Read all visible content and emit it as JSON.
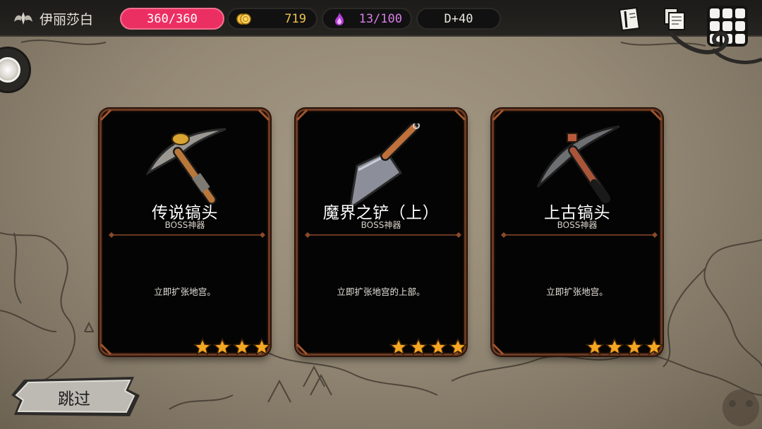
{
  "player": {
    "name": "伊丽莎白",
    "emblem_icon": "demon-wings-emblem-icon"
  },
  "stats": {
    "hp": "360/360",
    "gold": "719",
    "gold_icon": "gold-coins-icon",
    "soul": "13/100",
    "soul_icon": "purple-flame-icon",
    "day": "D+40"
  },
  "toolbar": {
    "journal_icon": "journal-book-icon",
    "notes_icon": "notes-scroll-icon",
    "menu_icon": "grid-menu-icon"
  },
  "cards": [
    {
      "title": "传说镐头",
      "subtitle": "BOSS神器",
      "description": "立即扩张地宫。",
      "rating": 4,
      "art_icon": "legendary-pickaxe-icon"
    },
    {
      "title": "魔界之铲（上）",
      "subtitle": "BOSS神器",
      "description": "立即扩张地宫的上部。",
      "rating": 4,
      "art_icon": "demon-realm-shovel-icon"
    },
    {
      "title": "上古镐头",
      "subtitle": "BOSS神器",
      "description": "立即扩张地宫。",
      "rating": 4,
      "art_icon": "ancient-pickaxe-icon"
    }
  ],
  "skip_button": {
    "label": "跳过"
  },
  "colors": {
    "hp": "#ec2f63",
    "gold": "#f0c44a",
    "soul": "#d77fe8",
    "card_border": "#6b3a22",
    "star": "#f5a623"
  }
}
